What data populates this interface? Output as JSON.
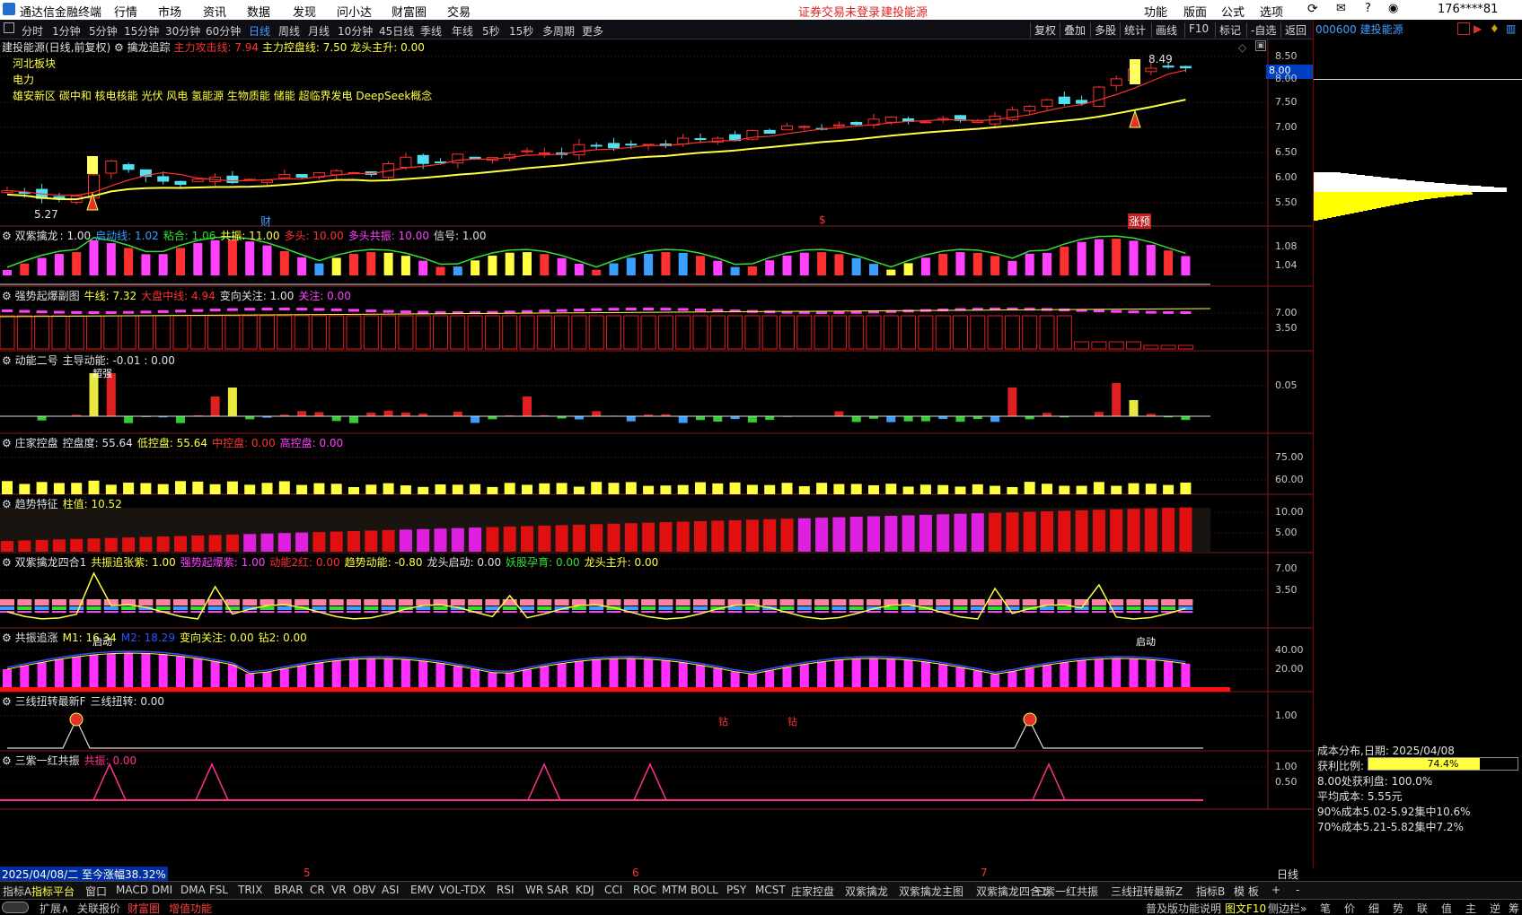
{
  "app_title": "通达信金融终端",
  "menu": [
    "行情",
    "市场",
    "资讯",
    "数据",
    "发现",
    "问小达",
    "财富圈",
    "交易"
  ],
  "login_warning": "证券交易未登录",
  "stock_name_top": "建投能源",
  "right_menu": [
    "功能",
    "版面",
    "公式",
    "选项"
  ],
  "user": "176****81",
  "periods": [
    "分时",
    "1分钟",
    "5分钟",
    "15分钟",
    "30分钟",
    "60分钟",
    "日线",
    "周线",
    "月线",
    "10分钟",
    "45日线",
    "季线",
    "年线",
    "5秒",
    "15秒",
    "多周期",
    "更多"
  ],
  "active_period": "日线",
  "right_buttons": [
    "复权",
    "叠加",
    "多股",
    "统计",
    "画线",
    "F10",
    "标记",
    "-自选",
    "返回"
  ],
  "stock_code_label": "000600 建投能源",
  "main": {
    "title": "建投能源(日线,前复权)",
    "indicator": "擒龙追踪",
    "attack_label": "主力攻击线: 7.94",
    "control_label": "主力控盘线: 7.50",
    "dragon_label": "龙头主升: 0.00",
    "sector1": "河北板块",
    "sector2": "电力",
    "concepts": "雄安新区 碳中和 核电核能 光伏 风电 氢能源 生物质能 储能 超临界发电 DeepSeek概念",
    "high_label": "8.49",
    "low_label": "5.27",
    "price_tag": "8.00",
    "yticks": [
      "8.50",
      "8.00",
      "7.50",
      "7.00",
      "6.50",
      "6.00",
      "5.50"
    ],
    "marker1": "财",
    "marker2": "$",
    "marker3": "涨预"
  },
  "panels": [
    {
      "title": "双紫擒龙",
      "parts": [
        [
          "",
          ": 1.00",
          "#e0e0e0"
        ],
        [
          "启动线: 1.02",
          "",
          "#3aa0ff"
        ],
        [
          "粘合: 1.06",
          "",
          "#30e030"
        ],
        [
          "共振: 11.00",
          "",
          "#ffff40"
        ],
        [
          "多头: 10.00",
          "",
          "#ff3030"
        ],
        [
          "多头共振: 10.00",
          "",
          "#ff40ff"
        ],
        [
          "信号: 1.00",
          "",
          "#e0e0e0"
        ]
      ],
      "yticks": [
        "1.08",
        "1.04"
      ]
    },
    {
      "title": "强势起爆副图",
      "parts": [
        [
          "牛线: 7.32",
          "",
          "#ffff40"
        ],
        [
          "大盘中线: 4.94",
          "",
          "#ff3030"
        ],
        [
          "变向关注: 1.00",
          "",
          "#e0e0e0"
        ],
        [
          "关注: 0.00",
          "",
          "#ff40ff"
        ]
      ],
      "yticks": [
        "7.00",
        "3.50"
      ]
    },
    {
      "title": "动能二号",
      "parts": [
        [
          "主导动能: -0.01 : 0.00",
          "",
          "#e0e0e0"
        ]
      ],
      "yticks": [
        "0.05"
      ],
      "annotation": "超强"
    },
    {
      "title": "庄家控盘",
      "parts": [
        [
          "控盘度: 55.64",
          "",
          "#e0e0e0"
        ],
        [
          "低控盘: 55.64",
          "",
          "#ffff40"
        ],
        [
          "中控盘: 0.00",
          "",
          "#ff3030"
        ],
        [
          "高控盘: 0.00",
          "",
          "#ff40ff"
        ]
      ],
      "yticks": [
        "75.00",
        "60.00"
      ]
    },
    {
      "title": "趋势特征",
      "parts": [
        [
          "柱值: 10.52",
          "",
          "#ffff40"
        ]
      ],
      "yticks": [
        "10.00",
        "5.00"
      ]
    },
    {
      "title": "双紫擒龙四合1",
      "parts": [
        [
          "共振追张紫: 1.00",
          "",
          "#ffff40"
        ],
        [
          "强势起爆紫: 1.00",
          "",
          "#ff40ff"
        ],
        [
          "动能2红: 0.00",
          "",
          "#ff3030"
        ],
        [
          "趋势动能: -0.80",
          "",
          "#ffff40"
        ],
        [
          "龙头启动: 0.00",
          "",
          "#e0e0e0"
        ],
        [
          "妖股孕育: 0.00",
          "",
          "#30e030"
        ],
        [
          "龙头主升: 0.00",
          "",
          "#ffff40"
        ]
      ],
      "yticks": [
        "7.00",
        "3.50"
      ],
      "annotation": "启动"
    },
    {
      "title": "共振追涨",
      "parts": [
        [
          "M1: 16.34",
          "",
          "#ffff40"
        ],
        [
          "M2: 18.29",
          "",
          "#3050ff"
        ],
        [
          "变向关注: 0.00",
          "",
          "#ffff40"
        ],
        [
          "钻2: 0.00",
          "",
          "#ffff40"
        ]
      ],
      "yticks": [
        "40.00",
        "20.00"
      ],
      "annotation": "钻"
    },
    {
      "title": "三线扭转最新F",
      "parts": [
        [
          "三线扭转: 0.00",
          "",
          "#e0e0e0"
        ]
      ],
      "yticks": [
        "1.00"
      ]
    },
    {
      "title": "三紫一红共振",
      "parts": [
        [
          "共振: 0.00",
          "",
          "#ff3090"
        ]
      ],
      "yticks": [
        "1.00",
        "0.50"
      ]
    }
  ],
  "time_axis": {
    "left_label": "2025/04/08/二  至今涨幅38.32%",
    "months": [
      "5",
      "6",
      "7"
    ],
    "right": "日线"
  },
  "bottom_tabs": [
    "指标A",
    "指标平台",
    "窗口",
    "MACD",
    "DMI",
    "DMA",
    "FSL",
    "TRIX",
    "BRAR",
    "CR",
    "VR",
    "OBV",
    "ASI",
    "EMV",
    "VOL-TDX",
    "RSI",
    "WR",
    "SAR",
    "KDJ",
    "CCI",
    "ROC",
    "MTM",
    "BOLL",
    "PSY",
    "MCST",
    "庄家控盘",
    "双紫擒龙",
    "双紫擒龙主图",
    "双紫擒龙四合1",
    "三紫一红共振",
    "三线扭转最新Z"
  ],
  "bottom_tabs_right": [
    "指标B",
    "模 板",
    "+",
    "-"
  ],
  "status_left": [
    "扩展∧",
    "关联报价",
    "财富圈",
    "增值功能"
  ],
  "status_right": [
    "普及版功能说明",
    "图文F10",
    "侧边栏»",
    "笔",
    "价",
    "细",
    "势",
    "联",
    "值",
    "主",
    "逆",
    "筹"
  ],
  "cost": {
    "title": "成本分布,日期: 2025/04/08",
    "profit_label": "获利比例:",
    "profit_value": "74.4%",
    "profit_fraction": 0.744,
    "line1": "8.00处获利盘: 100.0%",
    "line2": "平均成本: 5.55元",
    "line3": "90%成本5.02-5.92集中10.6%",
    "line4": "70%成本5.21-5.82集中7.2%"
  }
}
